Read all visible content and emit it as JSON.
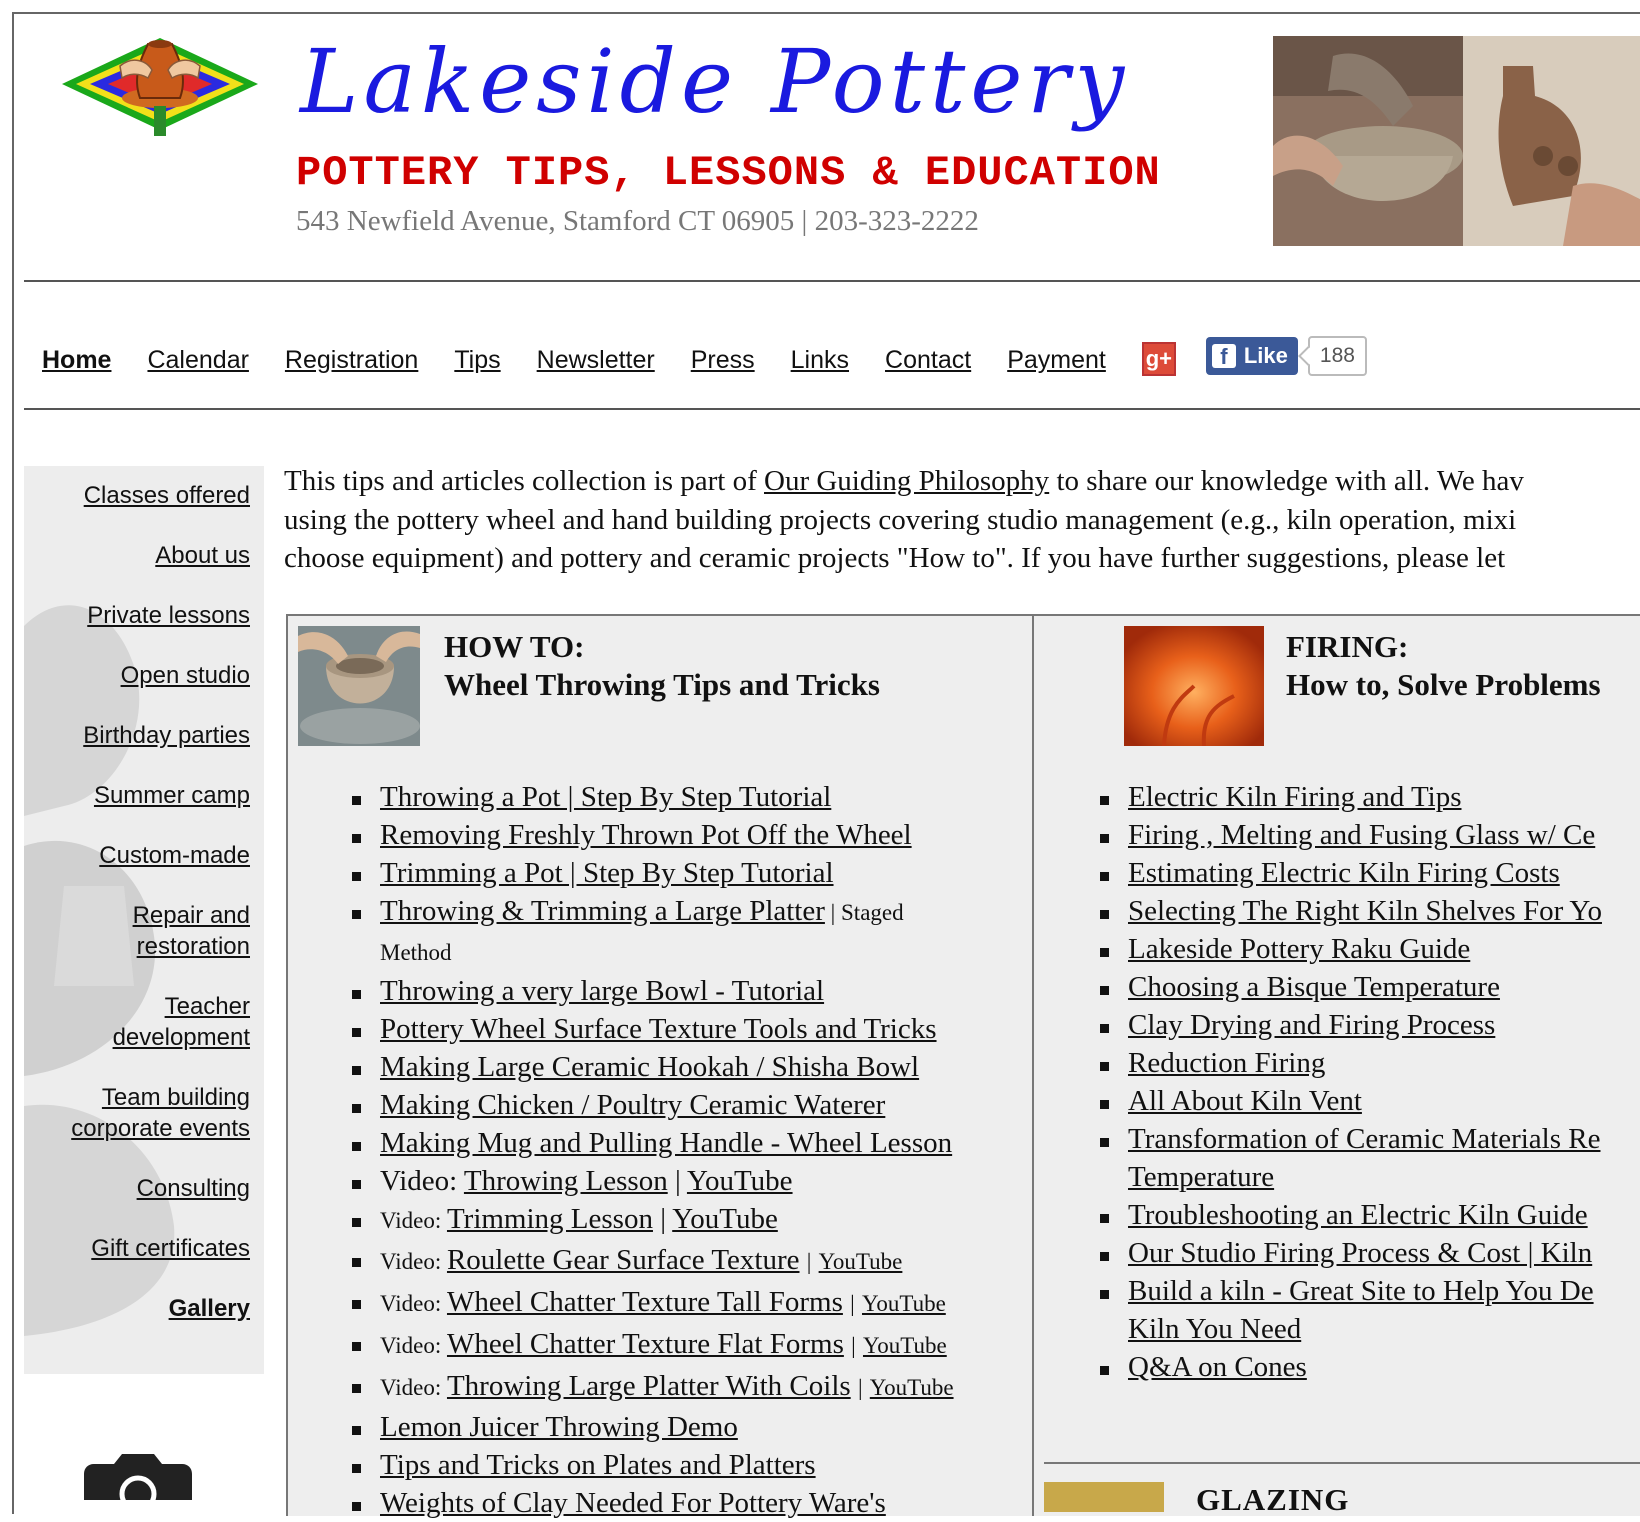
{
  "header": {
    "title": "Lakeside Pottery",
    "tagline": "POTTERY TIPS, LESSONS & EDUCATION",
    "address": "543 Newfield Avenue, Stamford CT 06905 | 203-323-2222"
  },
  "nav": {
    "items": [
      "Home",
      "Calendar",
      "Registration",
      "Tips",
      "Newsletter",
      "Press",
      "Links",
      "Contact",
      "Payment"
    ],
    "gplus_label": "g+",
    "fb_like_label": "Like",
    "fb_like_count": "188"
  },
  "sidebar": {
    "items": [
      "Classes offered",
      "About us",
      "Private lessons",
      "Open studio",
      "Birthday parties",
      "Summer camp",
      "Custom-made",
      "Repair and restoration",
      "Teacher development",
      "Team building corporate events",
      "Consulting",
      "Gift certificates",
      "Gallery"
    ]
  },
  "intro": {
    "line1_pre": "This tips and articles collection is part of ",
    "line1_link": "Our Guiding Philosophy",
    "line1_post": " to share our knowledge with all. We hav",
    "line2": "using the pottery wheel and hand building projects covering studio management (e.g., kiln operation, mixi",
    "line3": "choose equipment) and pottery and ceramic projects \"How to\". If you have further suggestions, please let"
  },
  "how_to": {
    "title_line1": "HOW TO:",
    "title_line2": "Wheel Throwing Tips and Tricks",
    "links": [
      "Throwing a Pot | Step By Step Tutorial",
      "Removing Freshly Thrown Pot Off the Wheel",
      "Trimming a Pot | Step By Step Tutorial",
      "Throwing & Trimming a Large Platter",
      "Throwing a very large Bowl - Tutorial",
      "Pottery Wheel Surface Texture Tools and Tricks",
      "Making Large Ceramic Hookah / Shisha Bowl",
      "Making Chicken / Poultry Ceramic Waterer",
      "Making Mug and Pulling Handle - Wheel Lesson"
    ],
    "staged_suffix": " | Staged",
    "staged_suffix2": "Method",
    "video_prefix": "Video: ",
    "youtube_label": "YouTube",
    "video_items": [
      "Throwing Lesson",
      "Trimming Lesson",
      "Roulette Gear Surface Texture",
      "Wheel Chatter Texture Tall Forms",
      "Wheel Chatter Texture Flat Forms",
      "Throwing Large Platter With Coils"
    ],
    "more_links": [
      "Lemon Juicer Throwing Demo",
      "Tips and Tricks on Plates and Platters",
      "Weights of Clay Needed For Pottery Ware's"
    ]
  },
  "firing": {
    "title_line1": "FIRING:",
    "title_line2": "How to, Solve Problems",
    "links": [
      "Electric Kiln Firing and Tips",
      "Firing , Melting and Fusing Glass w/ Ce",
      "Estimating Electric Kiln Firing Costs",
      "Selecting The Right Kiln Shelves For Yo",
      "Lakeside Pottery Raku Guide",
      "Choosing a Bisque Temperature",
      "Clay Drying and Firing Process",
      "Reduction Firing",
      "All About Kiln Vent",
      "Transformation of Ceramic Materials Re",
      "Temperature",
      "Troubleshooting an Electric Kiln Guide",
      "Our Studio Firing Process & Cost | Kiln",
      "Build a kiln - Great Site to Help You De",
      "Kiln You Need",
      "Q&A on Cones"
    ]
  },
  "glazing": {
    "title": "GLAZING"
  },
  "colors": {
    "title_blue": "#1a1adf",
    "tagline_red": "#d00000",
    "address_gray": "#777777",
    "panel_bg": "#eeeeee",
    "facebook": "#3b5998",
    "gplus": "#dd4b39"
  }
}
